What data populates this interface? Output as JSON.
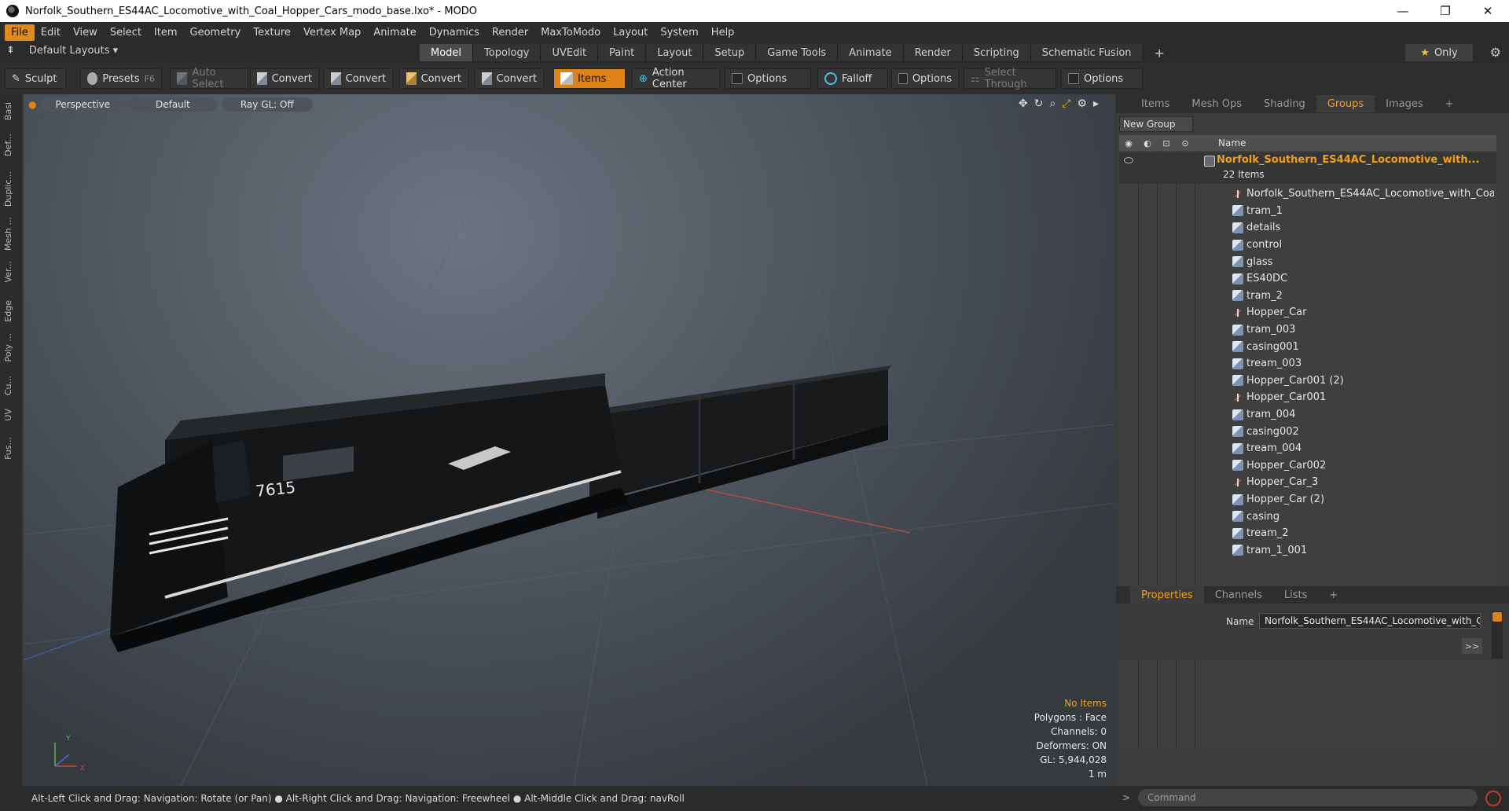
{
  "window": {
    "title": "Norfolk_Southern_ES44AC_Locomotive_with_Coal_Hopper_Cars_modo_base.lxo* - MODO",
    "controls": [
      "—",
      "❐",
      "✕"
    ]
  },
  "menu": [
    "File",
    "Edit",
    "View",
    "Select",
    "Item",
    "Geometry",
    "Texture",
    "Vertex Map",
    "Animate",
    "Dynamics",
    "Render",
    "MaxToModo",
    "Layout",
    "System",
    "Help"
  ],
  "layout_bar": {
    "layouts_label": "Default Layouts ▾",
    "tabs": [
      "Model",
      "Topology",
      "UVEdit",
      "Paint",
      "Layout",
      "Setup",
      "Game Tools",
      "Animate",
      "Render",
      "Scripting",
      "Schematic Fusion"
    ],
    "active_tab": "Model",
    "add": "+",
    "only": "Only",
    "star": "★"
  },
  "toolbar": {
    "sculpt": "Sculpt",
    "presets": "Presets",
    "presets_key": "F6",
    "auto_select": "Auto Select",
    "convert": "Convert",
    "items": "Items",
    "action_center": "Action Center",
    "options": "Options",
    "falloff": "Falloff",
    "select_through": "Select Through"
  },
  "left_tabs": [
    "Basi",
    "Def...",
    "Duplic...",
    "Mesh ...",
    "Ver...",
    "Edge",
    "Poly ...",
    "Cu...",
    "UV",
    "Fus..."
  ],
  "viewport": {
    "perspective": "Perspective",
    "shading": "Default",
    "raygl": "Ray GL: Off",
    "locomotive_number": "7615",
    "stats": {
      "selection": "No Items",
      "polygons": "Polygons : Face",
      "channels": "Channels: 0",
      "deformers": "Deformers: ON",
      "gl": "GL: 5,944,028",
      "scale": "1 m"
    },
    "axis_y": "Y",
    "axis_x": "X"
  },
  "right_panel": {
    "tabs": [
      "Items",
      "Mesh Ops",
      "Shading",
      "Groups",
      "Images",
      "+"
    ],
    "active_tab": "Groups",
    "new_group": "New Group",
    "column_name": "Name",
    "root": {
      "name": "Norfolk_Southern_ES44AC_Locomotive_with...",
      "count": "22 Items"
    },
    "items": [
      {
        "label": "Norfolk_Southern_ES44AC_Locomotive_with_Coal...",
        "type": "locator"
      },
      {
        "label": "tram_1",
        "type": "mesh"
      },
      {
        "label": "details",
        "type": "mesh"
      },
      {
        "label": "control",
        "type": "mesh"
      },
      {
        "label": "glass",
        "type": "mesh"
      },
      {
        "label": "ES40DC",
        "type": "mesh"
      },
      {
        "label": "tram_2",
        "type": "mesh"
      },
      {
        "label": "Hopper_Car",
        "type": "locator"
      },
      {
        "label": "tram_003",
        "type": "mesh"
      },
      {
        "label": "casing001",
        "type": "mesh"
      },
      {
        "label": "tream_003",
        "type": "mesh"
      },
      {
        "label": "Hopper_Car001 (2)",
        "type": "mesh"
      },
      {
        "label": "Hopper_Car001",
        "type": "locator"
      },
      {
        "label": "tram_004",
        "type": "mesh"
      },
      {
        "label": "casing002",
        "type": "mesh"
      },
      {
        "label": "tream_004",
        "type": "mesh"
      },
      {
        "label": "Hopper_Car002",
        "type": "mesh"
      },
      {
        "label": "Hopper_Car_3",
        "type": "locator"
      },
      {
        "label": "Hopper_Car (2)",
        "type": "mesh"
      },
      {
        "label": "casing",
        "type": "mesh"
      },
      {
        "label": "tream_2",
        "type": "mesh"
      },
      {
        "label": "tram_1_001",
        "type": "mesh"
      }
    ],
    "prop_tabs": [
      "Properties",
      "Channels",
      "Lists",
      "+"
    ],
    "active_prop_tab": "Properties",
    "prop_name_label": "Name",
    "prop_name_value": "Norfolk_Southern_ES44AC_Locomotive_with_C",
    "prop_more": ">>"
  },
  "statusbar": {
    "text": "Alt-Left Click and Drag: Navigation: Rotate (or Pan) ● Alt-Right Click and Drag: Navigation: Freewheel ● Alt-Middle Click and Drag: navRoll"
  },
  "command": {
    "prompt": ">",
    "placeholder": "Command"
  },
  "colors": {
    "accent": "#e0821a",
    "highlight_text": "#f0a020"
  }
}
